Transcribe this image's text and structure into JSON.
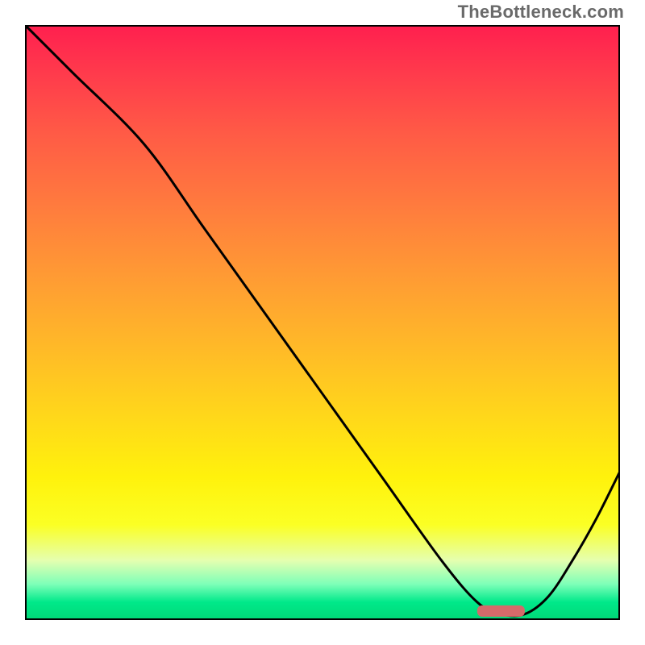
{
  "watermark": "TheBottleneck.com",
  "chart_data": {
    "type": "line",
    "title": "",
    "xlabel": "",
    "ylabel": "",
    "xlim": [
      0,
      100
    ],
    "ylim": [
      0,
      100
    ],
    "grid": false,
    "legend": false,
    "series": [
      {
        "name": "bottleneck-curve",
        "x": [
          0,
          8,
          20,
          30,
          40,
          50,
          60,
          70,
          76,
          80,
          84,
          88,
          92,
          96,
          100
        ],
        "values": [
          100,
          92,
          80,
          66,
          52,
          38,
          24,
          10,
          3,
          1,
          1,
          4,
          10,
          17,
          25
        ]
      }
    ],
    "marker": {
      "name": "optimal-range",
      "x_start": 76,
      "x_end": 84,
      "y": 1.5,
      "color": "#d46a6a"
    },
    "background_gradient": {
      "direction": "vertical",
      "stops": [
        {
          "pos": 0.0,
          "color": "#ff1f4f"
        },
        {
          "pos": 0.5,
          "color": "#ffc020"
        },
        {
          "pos": 0.8,
          "color": "#fff20c"
        },
        {
          "pos": 0.95,
          "color": "#7dffb8"
        },
        {
          "pos": 1.0,
          "color": "#00d876"
        }
      ]
    }
  }
}
